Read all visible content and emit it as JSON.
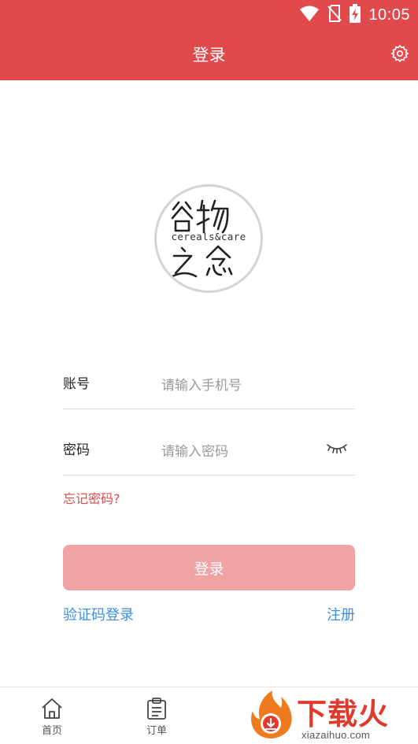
{
  "status_bar": {
    "time": "10:05",
    "icons": [
      "wifi-icon",
      "no-sim-icon",
      "battery-charging-icon"
    ]
  },
  "header": {
    "title": "登录",
    "settings_icon": "gear-icon"
  },
  "logo": {
    "top_text": "谷物",
    "sub_text": "cereals&care",
    "bottom_text": "之念"
  },
  "form": {
    "account": {
      "label": "账号",
      "placeholder": "请输入手机号",
      "value": ""
    },
    "password": {
      "label": "密码",
      "placeholder": "请输入密码",
      "value": "",
      "toggle_icon": "eye-closed-icon"
    },
    "forgot_label": "忘记密码?",
    "login_button": "登录",
    "sms_login_link": "验证码登录",
    "register_link": "注册"
  },
  "tabs": [
    {
      "label": "首页",
      "icon": "home-icon"
    },
    {
      "label": "订单",
      "icon": "clipboard-icon"
    }
  ],
  "watermark": {
    "text": "下载火",
    "url": "xiazaihuo.com"
  },
  "colors": {
    "brand_red": "#e04a4d",
    "button_disabled": "#f0a3a5",
    "link_blue": "#3d8de0"
  }
}
